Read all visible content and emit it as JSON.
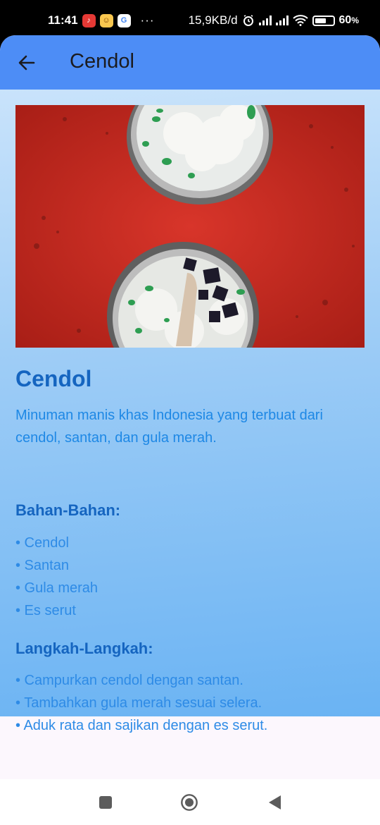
{
  "status_bar": {
    "time": "11:41",
    "network_speed": "15,9KB/d",
    "battery_percent": "60",
    "battery_suffix": "%",
    "more": "···",
    "app_icons": [
      "tiktok-icon",
      "game-icon",
      "google-icon"
    ]
  },
  "app_bar": {
    "title": "Cendol",
    "back_icon": "arrow-back-icon"
  },
  "recipe": {
    "title": "Cendol",
    "description": "Minuman manis khas Indonesia yang terbuat dari cendol, santan, dan gula merah.",
    "ingredients_heading": "Bahan-Bahan:",
    "ingredients": [
      "• Cendol",
      "• Santan",
      "• Gula merah",
      "• Es serut"
    ],
    "steps_heading": "Langkah-Langkah:",
    "steps": [
      "• Campurkan cendol dengan santan.",
      "• Tambahkan gula merah sesuai selera.",
      "• Aduk rata dan sajikan dengan es serut."
    ]
  },
  "colors": {
    "app_bar": "#4d8df6",
    "title": "#1565c0",
    "body_text": "#1e88e5",
    "photo_background": "#c62d22"
  },
  "nav_bar": {
    "icons": [
      "recents-icon",
      "home-icon",
      "back-triangle-icon"
    ]
  }
}
